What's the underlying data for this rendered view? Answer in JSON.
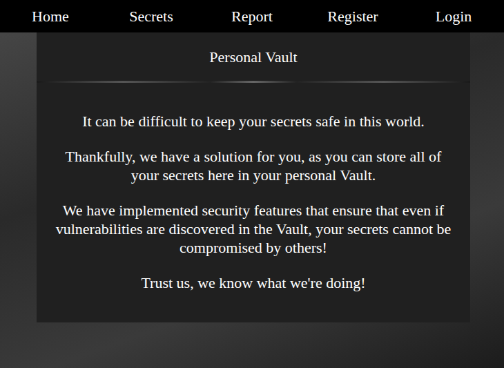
{
  "nav": {
    "items": [
      {
        "label": "Home"
      },
      {
        "label": "Secrets"
      },
      {
        "label": "Report"
      },
      {
        "label": "Register"
      },
      {
        "label": "Login"
      }
    ]
  },
  "panel": {
    "title": "Personal Vault",
    "paragraphs": [
      "It can be difficult to keep your secrets safe in this world.",
      "Thankfully, we have a solution for you, as you can store all of your secrets here in your personal Vault.",
      "We have implemented security features that ensure that even if vulnerabilities are discovered in the Vault, your secrets cannot be compromised by others!",
      "Trust us, we know what we're doing!"
    ]
  }
}
